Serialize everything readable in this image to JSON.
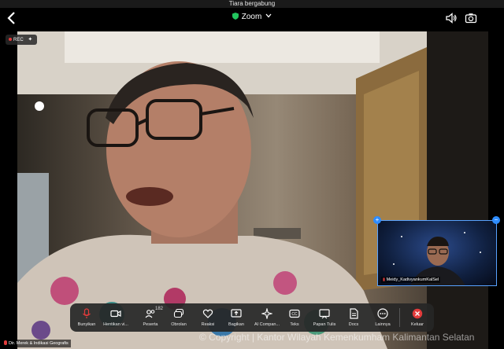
{
  "notification": {
    "text": "Tiara bergabung"
  },
  "header": {
    "title": "Zoom"
  },
  "recording": {
    "label": "REC"
  },
  "thumbnail": {
    "name": "Meidy_KadivyankumKalSel"
  },
  "toolbar": {
    "items": [
      {
        "label": "Bunyikan"
      },
      {
        "label": "Hentikan vi..."
      },
      {
        "label": "Peserta",
        "badge": "182"
      },
      {
        "label": "Obrolan"
      },
      {
        "label": "Reaksi"
      },
      {
        "label": "Bagikan"
      },
      {
        "label": "AI Compan..."
      },
      {
        "label": "Teks"
      },
      {
        "label": "Papan Tulis"
      },
      {
        "label": "Docs"
      },
      {
        "label": "Lainnya"
      },
      {
        "label": "Keluar"
      }
    ]
  },
  "speaker_caption": {
    "text": "Dir. Merek & Indikasi Geografis"
  },
  "watermark": {
    "text": "© Copyright | Kantor Wilayah Kemenkumham Kalimantan Selatan"
  },
  "colors": {
    "accent": "#2d8cff",
    "leave": "#e23b3b",
    "secure": "#22c55e"
  }
}
